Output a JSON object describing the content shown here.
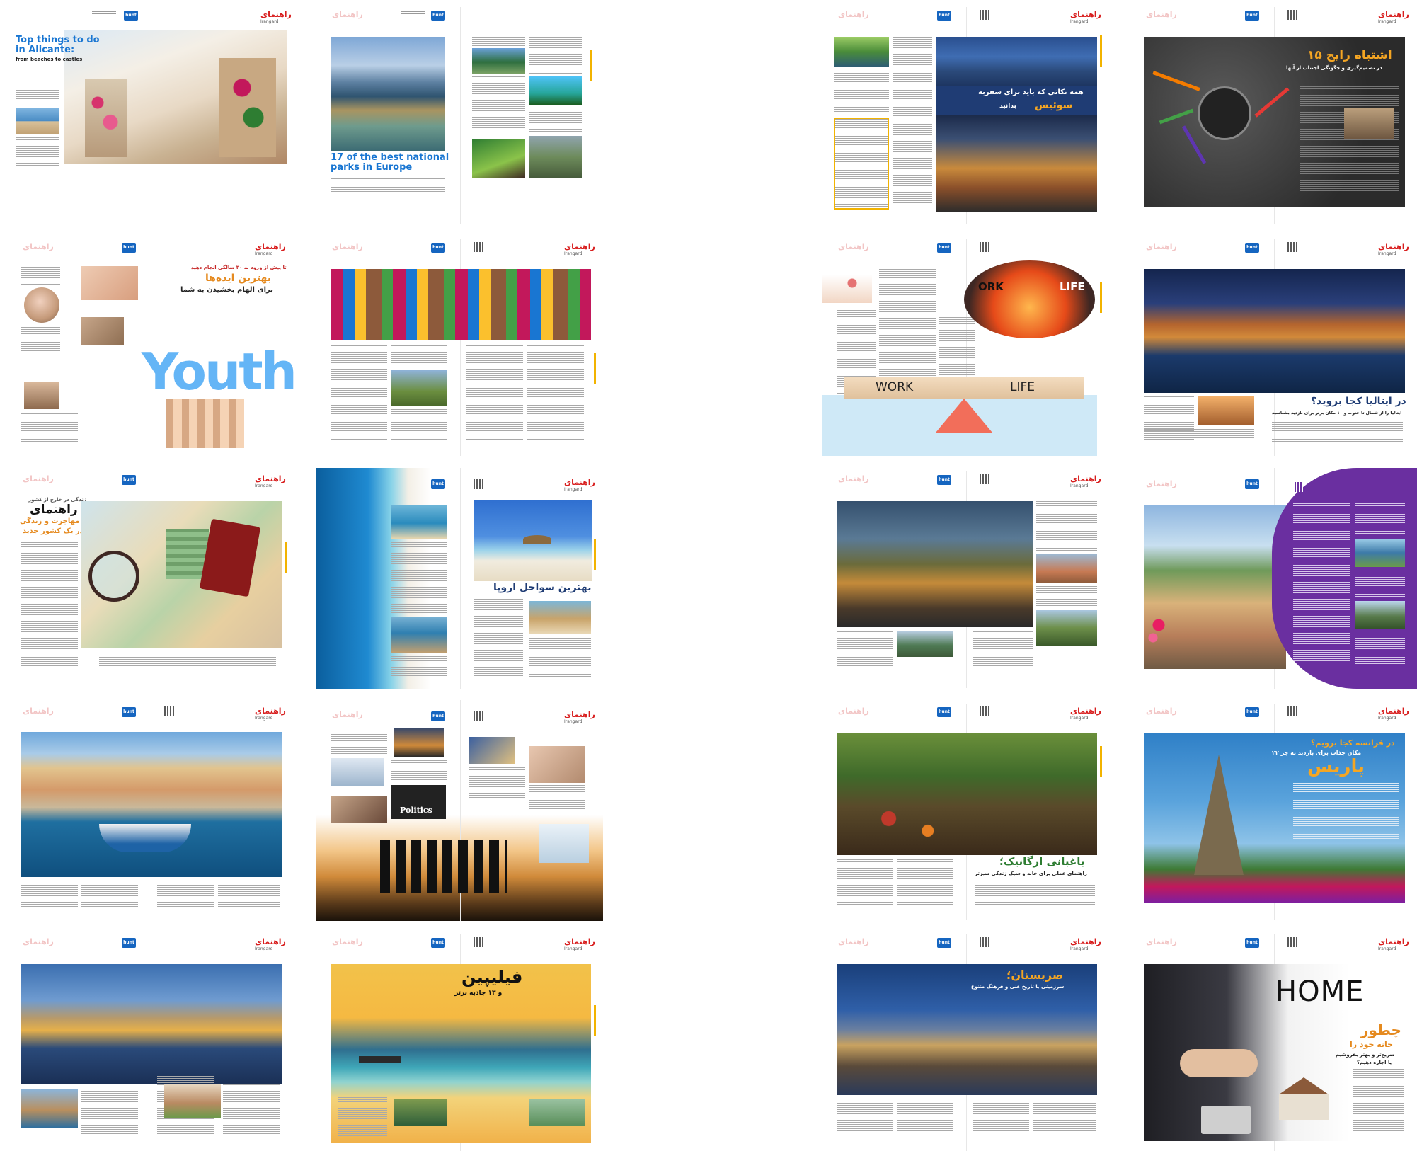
{
  "brand": {
    "magazine_logo": "راهنمای",
    "magazine_sub": "Irangard",
    "hunt_label": "hunt"
  },
  "spreads": [
    {
      "id": "alicante-1",
      "title_line1": "Top things to do",
      "title_line2": "in Alicante:",
      "subtitle": "from beaches to castles"
    },
    {
      "id": "national-parks",
      "title_line1": "17 of the best national",
      "title_line2": "parks in Europe"
    },
    {
      "id": "switzerland",
      "title_line1": "همه نکاتی که باید برای سفربه",
      "title_line2": "سوئیس",
      "title_suffix": "بدانید"
    },
    {
      "id": "mistakes",
      "title_line1": "۱۵ اشتباه رایج",
      "subtitle": "در تصمیم‌گیری و چگونگی اجتناب از آنها"
    },
    {
      "id": "youth",
      "kicker": "تا پیش از ورود به ۳۰ سالگی انجام دهید",
      "title_line1": "بهترین ایده‌ها",
      "title_line2": "برای الهام بخشیدن به شما",
      "big_word": "Youth"
    },
    {
      "id": "indigenous"
    },
    {
      "id": "work-life",
      "word_left": "WORK",
      "word_right": "LIFE",
      "circle_left": "ORK",
      "circle_right": "LIFE"
    },
    {
      "id": "italy",
      "title_line1": "در ایتالیا کجا بروید؟",
      "subtitle": "ایتالیا را از شمال تا جنوب و ۱۰ مکان برتر برای بازدید بشناسید"
    },
    {
      "id": "immigration",
      "kicker": "زندگی در خارج از کشور",
      "title_line1": "راهنمای",
      "title_line2": "مهاجرت و زندگی",
      "title_line3": "در یک کشور جدید"
    },
    {
      "id": "beaches",
      "title_line1": "بهترین سواحل اروپا"
    },
    {
      "id": "city-night"
    },
    {
      "id": "purple-lake"
    },
    {
      "id": "symi"
    },
    {
      "id": "politics",
      "politics_label": "Politics"
    },
    {
      "id": "organic",
      "title_line1": "باغبانی ارگانیک؛",
      "subtitle": "راهنمای عملی برای خانه و سبک زندگی سبزتر"
    },
    {
      "id": "paris",
      "title_line1": "در فرانسه کجا برویم؟",
      "title_line2": "۲۲ مکان جذاب برای بازدید به جز",
      "title_line3": "پاریس"
    },
    {
      "id": "alicante-2"
    },
    {
      "id": "philippines",
      "title_line1": "فیلیپین",
      "title_line2": "و ۱۳ جاذبه برتر"
    },
    {
      "id": "serbia",
      "title_line1": "صربستان؛",
      "subtitle": "سرزمینی با تاریخ غنی و فرهنگ متنوع"
    },
    {
      "id": "home",
      "big_word": "HOME",
      "title_line1": "چطور",
      "title_line2": "خانه خود را",
      "subtitle": "سریع‌تر و بهتر بفروشیم",
      "subtitle2": "یا اجاره دهیم؟"
    }
  ],
  "colors": {
    "accent_orange": "#e58a1f",
    "brand_blue": "#1565c0",
    "logo_red": "#d81e1e",
    "purple": "#6a2fa0"
  }
}
